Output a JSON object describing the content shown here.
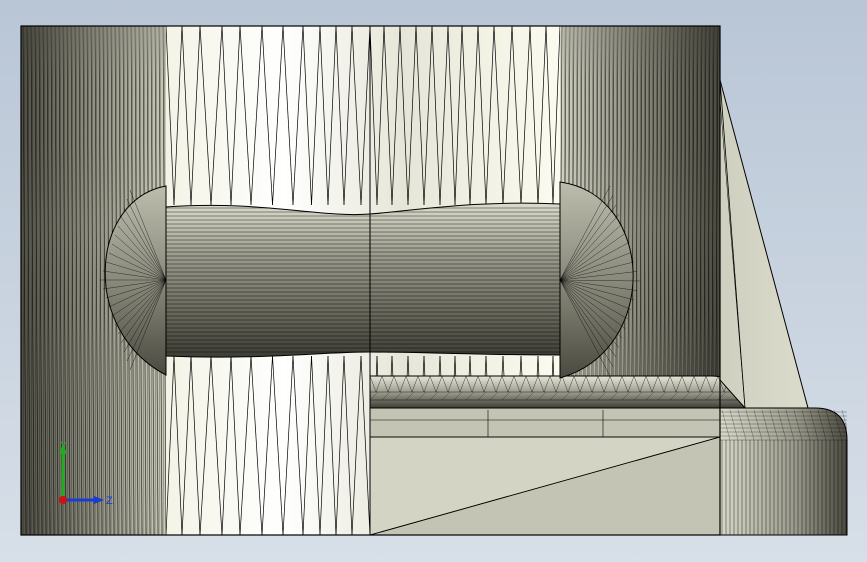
{
  "viewport": {
    "background_top": "#b9c6d6",
    "background_bottom": "#d7dfe8"
  },
  "model": {
    "edge_color": "#000000",
    "face_light": "#fbfbf2",
    "face_mid": "#cfcfc0",
    "face_dark": "#55554a"
  },
  "triad": {
    "y_label": "Y",
    "z_label": "Z",
    "y_color": "#22aa22",
    "z_color": "#1a3cd6",
    "x_color": "#cc1111"
  }
}
